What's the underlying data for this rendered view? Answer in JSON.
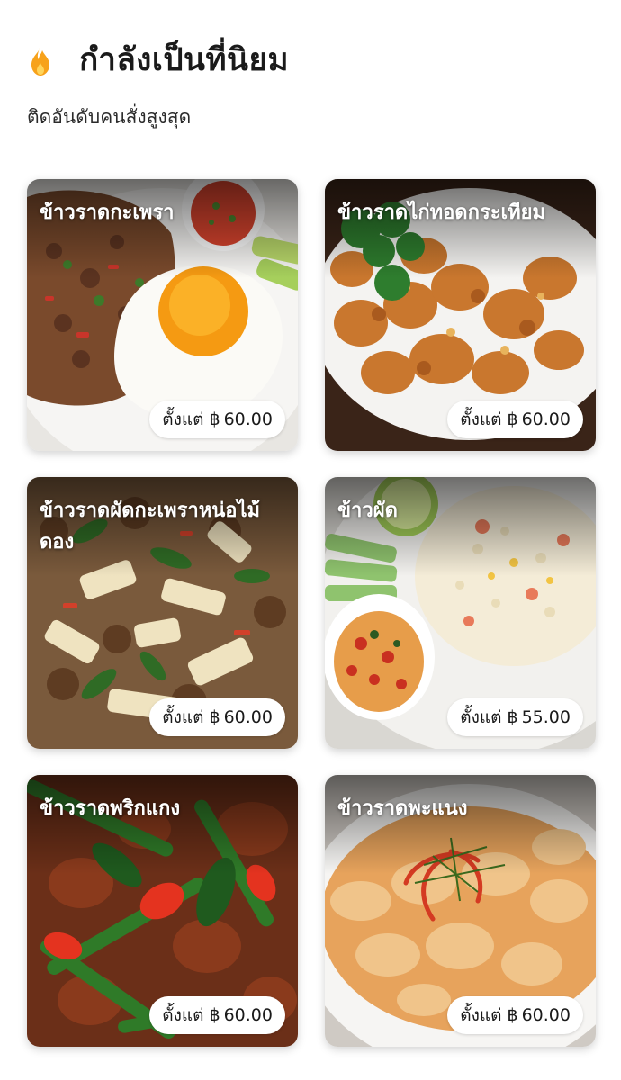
{
  "section": {
    "icon": "flame-icon",
    "title": "กำลังเป็นที่นิยม",
    "subtitle": "ติดอันดับคนสั่งสูงสุด",
    "accent_color": "#F7A21B"
  },
  "price_prefix": "ตั้งแต่",
  "currency": "฿",
  "items": [
    {
      "name": "ข้าวราดกะเพรา",
      "price": "60.00",
      "image": "basil-pork-fried-egg-photo"
    },
    {
      "name": "ข้าวราดไก่ทอดกระเทียม",
      "price": "60.00",
      "image": "garlic-fried-chicken-photo"
    },
    {
      "name": "ข้าวราดผัดกะเพราหน่อไม้ดอง",
      "price": "60.00",
      "image": "basil-bamboo-shoot-photo"
    },
    {
      "name": "ข้าวผัด",
      "price": "55.00",
      "image": "fried-rice-photo"
    },
    {
      "name": "ข้าวราดพริกแกง",
      "price": "60.00",
      "image": "red-curry-stir-fry-photo"
    },
    {
      "name": "ข้าวราดพะแนง",
      "price": "60.00",
      "image": "panang-curry-photo"
    }
  ]
}
